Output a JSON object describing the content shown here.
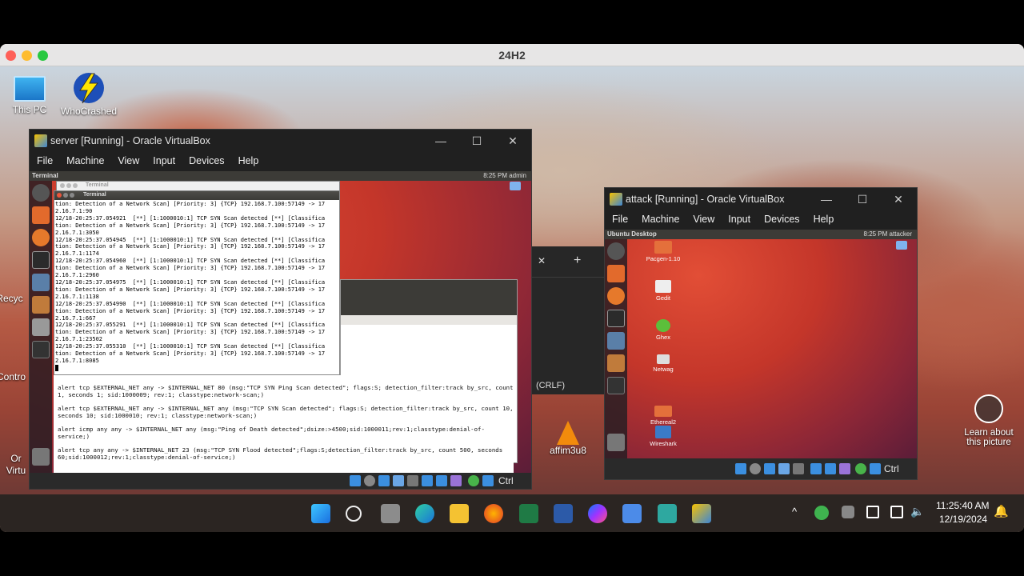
{
  "host_window": {
    "title": "24H2"
  },
  "desktop_icons": {
    "this_pc": "This PC",
    "whocrashed": "WhoCrashed",
    "recycle": "Recyc",
    "control": "Contro",
    "oracle": "Or",
    "virtu": "Virtu",
    "affim": "affim3u8"
  },
  "server_vm": {
    "title": "server [Running] - Oracle VirtualBox",
    "menu": [
      "File",
      "Machine",
      "View",
      "Input",
      "Devices",
      "Help"
    ],
    "ubuntu_panel_title": "Terminal",
    "panel_right": "8:25 PM  admin",
    "terminal_title_back": "Terminal",
    "terminal_title": "Terminal",
    "terminal_lines": [
      "tion: Detection of a Network Scan] [Priority: 3] {TCP} 192.168.7.100:57149 -> 17",
      "2.16.7.1:90",
      "12/18-20:25:37.054921  [**] [1:1000010:1] TCP SYN Scan detected [**] [Classifica",
      "tion: Detection of a Network Scan] [Priority: 3] {TCP} 192.168.7.100:57149 -> 17",
      "2.16.7.1:3050",
      "12/18-20:25:37.054945  [**] [1:1000010:1] TCP SYN Scan detected [**] [Classifica",
      "tion: Detection of a Network Scan] [Priority: 3] {TCP} 192.168.7.100:57149 -> 17",
      "2.16.7.1:1174",
      "12/18-20:25:37.054960  [**] [1:1000010:1] TCP SYN Scan detected [**] [Classifica",
      "tion: Detection of a Network Scan] [Priority: 3] {TCP} 192.168.7.100:57149 -> 17",
      "2.16.7.1:2960",
      "12/18-20:25:37.054975  [**] [1:1000010:1] TCP SYN Scan detected [**] [Classifica",
      "tion: Detection of a Network Scan] [Priority: 3] {TCP} 192.168.7.100:57149 -> 17",
      "2.16.7.1:1138",
      "12/18-20:25:37.054990  [**] [1:1000010:1] TCP SYN Scan detected [**] [Classifica",
      "tion: Detection of a Network Scan] [Priority: 3] {TCP} 192.168.7.100:57149 -> 17",
      "2.16.7.1:667",
      "12/18-20:25:37.055291  [**] [1:1000010:1] TCP SYN Scan detected [**] [Classifica",
      "tion: Detection of a Network Scan] [Priority: 3] {TCP} 192.168.7.100:57149 -> 17",
      "2.16.7.1:23502",
      "12/18-20:25:37.055310  [**] [1:1000010:1] TCP SYN Scan detected [**] [Classifica",
      "tion: Detection of a Network Scan] [Priority: 3] {TCP} 192.168.7.100:57149 -> 17",
      "2.16.7.1:8085"
    ],
    "rules": [
      "alert tcp $EXTERNAL_NET any -> $INTERNAL_NET 80 (msg:\"TCP SYN Ping Scan detected\"; flags:S; detection_filter:track by_src, count 1, seconds 1; sid:1000009; rev:1; classtype:network-scan;)",
      "alert tcp $EXTERNAL_NET any -> $INTERNAL_NET any (msg:\"TCP SYN Scan detected\"; flags:S; detection_filter:track by_src, count 10, seconds 10; sid:1000010; rev:1; classtype:network-scan;)",
      "alert icmp any any -> $INTERNAL_NET any (msg:\"Ping of Death detected\";dsize:>4500;sid:1000011;rev:1;classtype:denial-of-service;)",
      "alert tcp any any -> $INTERNAL_NET 23 (msg:\"TCP SYN Flood detected\";flags:S;detection_filter:track by_src, count 500, seconds 60;sid:1000012;rev:1;classtype:denial-of-service;)"
    ],
    "status_ctrl": "Ctrl"
  },
  "notepad_bg": {
    "close": "✕",
    "add": "+",
    "encoding": "(CRLF)"
  },
  "attack_vm": {
    "title": "attack [Running] - Oracle VirtualBox",
    "menu": [
      "File",
      "Machine",
      "View",
      "Input",
      "Devices",
      "Help"
    ],
    "ubuntu_panel_title": "Ubuntu Desktop",
    "panel_right": "8:25 PM  attacker",
    "icons": [
      "Pacgen-1.10",
      "Gedit",
      "Ghex",
      "Netwag",
      "Ethereal2",
      "Wireshark"
    ],
    "status_ctrl": "Ctrl"
  },
  "learn_about": "Learn about this picture",
  "clock": {
    "time": "11:25:40 AM",
    "date": "12/19/2024"
  },
  "colors": {
    "taskbar": "#2b2522",
    "vbox_dark": "#202020",
    "ubuntu_panel": "#3c3b37"
  }
}
